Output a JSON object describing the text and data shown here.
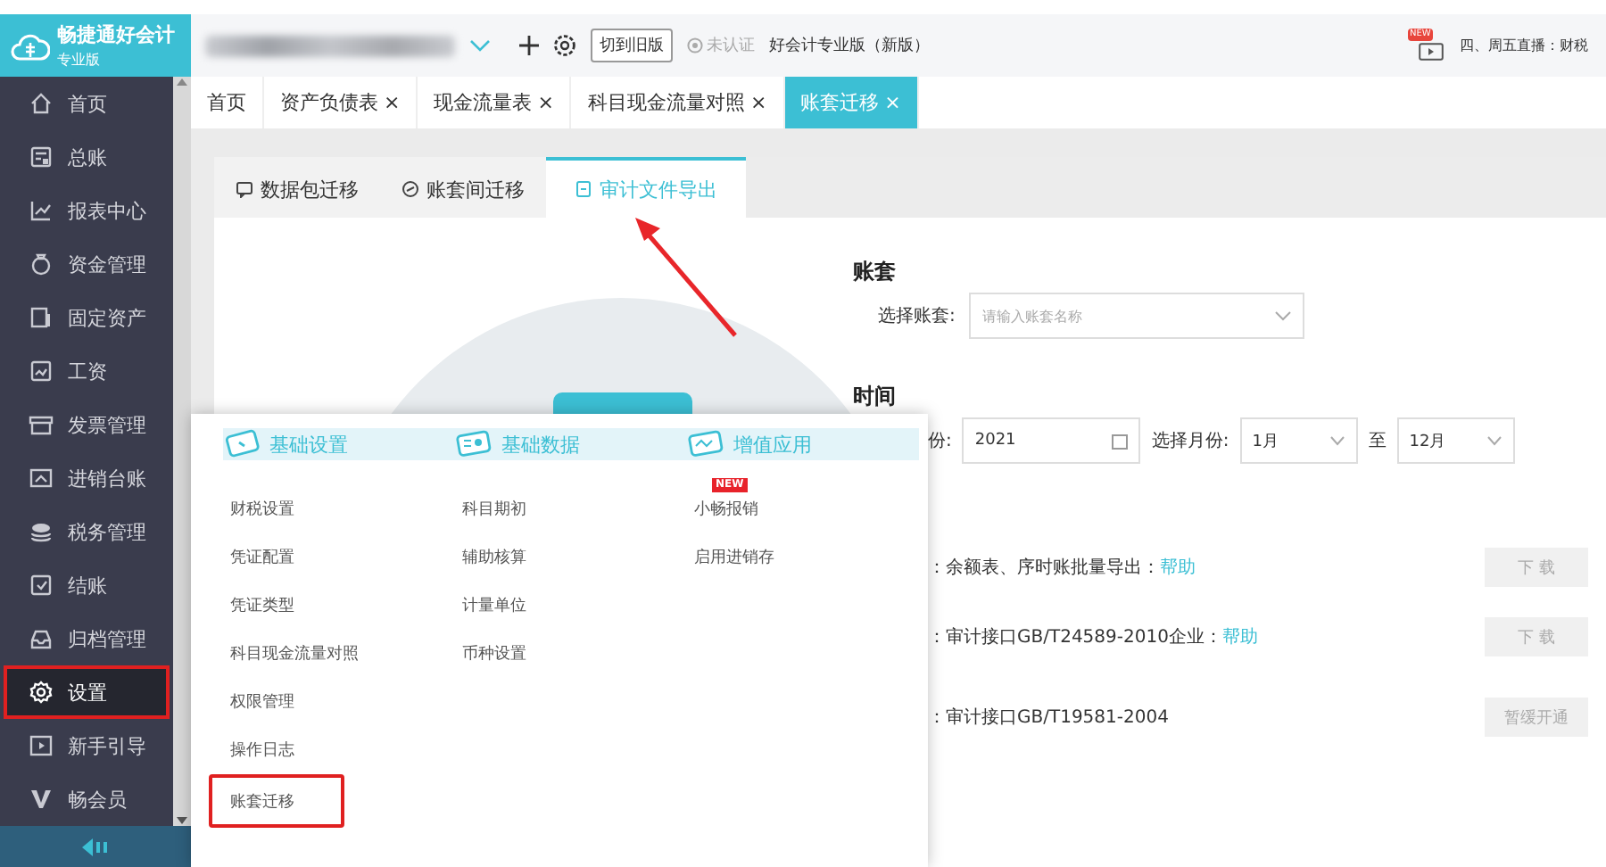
{
  "app": {
    "name": "畅捷通好会计",
    "edition": "专业版"
  },
  "header": {
    "old_version_button": "切到旧版",
    "cert_status": "未认证",
    "product": "好会计专业版（新版）",
    "live_badge": "NEW",
    "live_text": "四、周五直播：财税"
  },
  "sidebar": {
    "items": [
      {
        "label": "首页",
        "selected": false,
        "highlighted": false
      },
      {
        "label": "总账",
        "selected": false,
        "highlighted": false
      },
      {
        "label": "报表中心",
        "selected": false,
        "highlighted": false
      },
      {
        "label": "资金管理",
        "selected": false,
        "highlighted": false
      },
      {
        "label": "固定资产",
        "selected": false,
        "highlighted": false
      },
      {
        "label": "工资",
        "selected": false,
        "highlighted": false
      },
      {
        "label": "发票管理",
        "selected": false,
        "highlighted": false
      },
      {
        "label": "进销台账",
        "selected": false,
        "highlighted": false
      },
      {
        "label": "税务管理",
        "selected": false,
        "highlighted": false
      },
      {
        "label": "结账",
        "selected": false,
        "highlighted": false
      },
      {
        "label": "归档管理",
        "selected": false,
        "highlighted": false
      },
      {
        "label": "设置",
        "selected": true,
        "highlighted": true
      },
      {
        "label": "新手引导",
        "selected": false,
        "highlighted": false
      },
      {
        "label": "畅会员",
        "selected": false,
        "highlighted": false
      }
    ]
  },
  "tabs": [
    {
      "label": "首页",
      "selected": false
    },
    {
      "label": "资产负债表",
      "close": "×",
      "selected": false
    },
    {
      "label": "现金流量表",
      "close": "×",
      "selected": false
    },
    {
      "label": "科目现金流量对照",
      "close": "×",
      "selected": false
    },
    {
      "label": "账套迁移",
      "close": "×",
      "selected": true
    }
  ],
  "subtabs": [
    {
      "label": "数据包迁移",
      "selected": false
    },
    {
      "label": "账套间迁移",
      "selected": false
    },
    {
      "label": "审计文件导出",
      "selected": true
    }
  ],
  "form": {
    "account_section": "账套",
    "account_label": "选择账套:",
    "account_placeholder": "请输入账套名称",
    "time_section": "时间",
    "year_label": "份:",
    "year_value": "2021",
    "month_label": "选择月份:",
    "month_from": "1月",
    "to_label": "至",
    "month_to": "12月",
    "exports": [
      {
        "text": "：余额表、序时账批量导出：",
        "help": "帮助",
        "button": "下 载",
        "disabled": true
      },
      {
        "text": "：审计接口GB/T24589-2010企业：",
        "help": "帮助",
        "button": "下 载",
        "disabled": true
      },
      {
        "text": "：审计接口GB/T19581-2004",
        "button": "暂缓开通",
        "disabled": true
      }
    ]
  },
  "menu": {
    "columns": [
      {
        "title": "基础设置",
        "items": [
          {
            "label": "财税设置",
            "highlighted": false
          },
          {
            "label": "凭证配置",
            "highlighted": false
          },
          {
            "label": "凭证类型",
            "highlighted": false
          },
          {
            "label": "科目现金流量对照",
            "highlighted": false
          },
          {
            "label": "权限管理",
            "highlighted": false
          },
          {
            "label": "操作日志",
            "highlighted": false
          },
          {
            "label": "账套迁移",
            "highlighted": true
          }
        ]
      },
      {
        "title": "基础数据",
        "items": [
          {
            "label": "科目期初",
            "highlighted": false
          },
          {
            "label": "辅助核算",
            "highlighted": false
          },
          {
            "label": "计量单位",
            "highlighted": false
          },
          {
            "label": "币种设置",
            "highlighted": false
          }
        ]
      },
      {
        "title": "增值应用",
        "items": [
          {
            "label": "小畅报销",
            "badge": "NEW",
            "highlighted": false
          },
          {
            "label": "启用进销存",
            "highlighted": false
          }
        ]
      }
    ]
  }
}
